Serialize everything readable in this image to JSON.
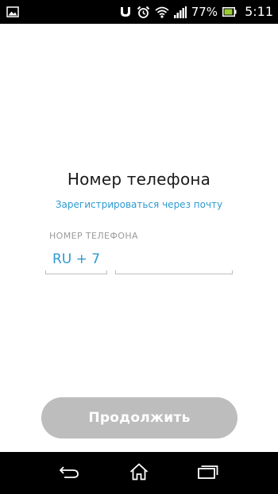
{
  "status_bar": {
    "battery_percent": "77%",
    "time": "5:11",
    "icons": [
      "image-notification-icon",
      "voicemail-icon",
      "alarm-icon",
      "wifi-icon",
      "signal-icon",
      "battery-icon"
    ]
  },
  "page": {
    "title": "Номер телефона",
    "email_link": "Зарегистрироваться через почту",
    "field_label": "НОМЕР ТЕЛЕФОНА",
    "country_code": "RU + 7",
    "phone_value": "",
    "phone_placeholder": "",
    "continue_label": "Продолжить"
  },
  "colors": {
    "accent": "#2e9ad0",
    "button_disabled": "#bdbdbd",
    "label_gray": "#9a9a9a"
  },
  "nav_bar": {
    "icons": [
      "back-icon",
      "home-icon",
      "recent-apps-icon"
    ]
  }
}
